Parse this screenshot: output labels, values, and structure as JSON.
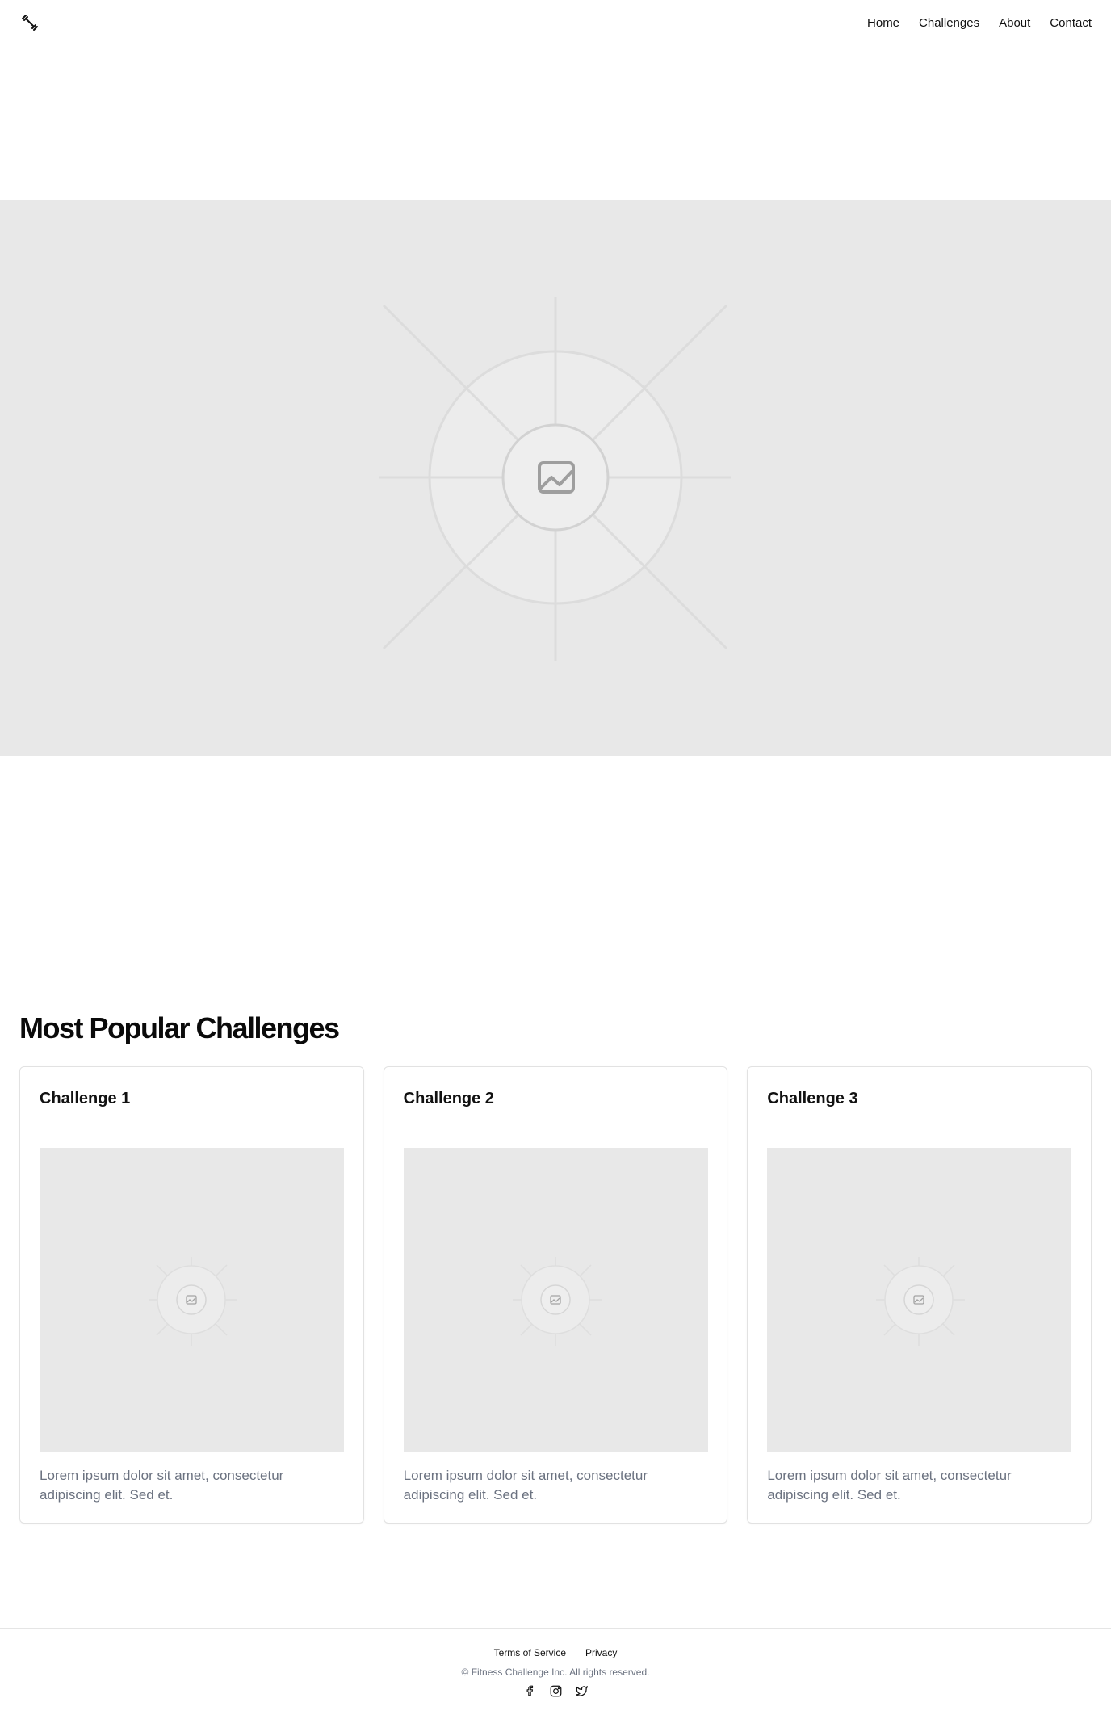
{
  "header": {
    "logo_icon": "dumbbell-icon",
    "nav": [
      {
        "label": "Home"
      },
      {
        "label": "Challenges"
      },
      {
        "label": "About"
      },
      {
        "label": "Contact"
      }
    ]
  },
  "hero": {
    "image_icon": "image-placeholder-icon"
  },
  "popular": {
    "title": "Most Popular Challenges",
    "cards": [
      {
        "title": "Challenge 1",
        "text": "Lorem ipsum dolor sit amet, consectetur adipiscing elit. Sed et.",
        "image_icon": "image-placeholder-icon"
      },
      {
        "title": "Challenge 2",
        "text": "Lorem ipsum dolor sit amet, consectetur adipiscing elit. Sed et.",
        "image_icon": "image-placeholder-icon"
      },
      {
        "title": "Challenge 3",
        "text": "Lorem ipsum dolor sit amet, consectetur adipiscing elit. Sed et.",
        "image_icon": "image-placeholder-icon"
      }
    ]
  },
  "footer": {
    "links": [
      {
        "label": "Terms of Service"
      },
      {
        "label": "Privacy"
      }
    ],
    "copyright": "© Fitness Challenge Inc. All rights reserved.",
    "social_icons": [
      "facebook-icon",
      "instagram-icon",
      "twitter-icon"
    ]
  },
  "colors": {
    "placeholder_bg": "#e8e8e8",
    "muted_text": "#6b7280",
    "border": "#e2e2e2"
  }
}
